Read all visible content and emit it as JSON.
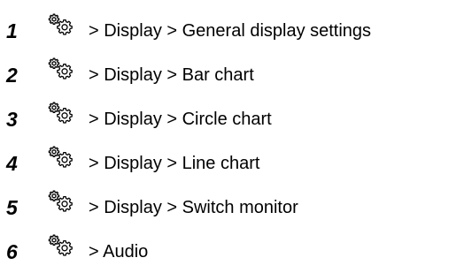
{
  "steps": [
    {
      "number": "1",
      "icon": "gears-icon",
      "path": "> Display > General display settings"
    },
    {
      "number": "2",
      "icon": "gears-icon",
      "path": "> Display > Bar chart"
    },
    {
      "number": "3",
      "icon": "gears-icon",
      "path": "> Display > Circle chart"
    },
    {
      "number": "4",
      "icon": "gears-icon",
      "path": "> Display > Line chart"
    },
    {
      "number": "5",
      "icon": "gears-icon",
      "path": "> Display > Switch monitor"
    },
    {
      "number": "6",
      "icon": "gears-icon",
      "path": "> Audio"
    }
  ]
}
